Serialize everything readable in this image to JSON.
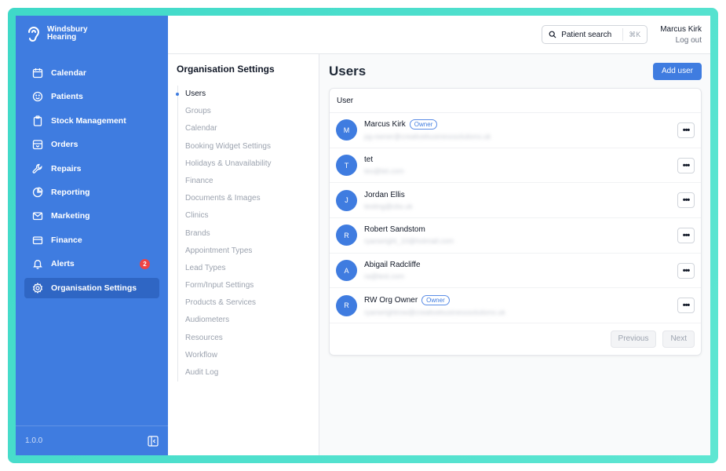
{
  "brand": {
    "name_line1": "Windsbury",
    "name_line2": "Hearing"
  },
  "sidebar": {
    "items": [
      {
        "label": "Calendar",
        "icon": "calendar-icon"
      },
      {
        "label": "Patients",
        "icon": "smile-icon"
      },
      {
        "label": "Stock Management",
        "icon": "clipboard-icon"
      },
      {
        "label": "Orders",
        "icon": "archive-icon"
      },
      {
        "label": "Repairs",
        "icon": "wrench-icon"
      },
      {
        "label": "Reporting",
        "icon": "pie-chart-icon"
      },
      {
        "label": "Marketing",
        "icon": "mail-icon"
      },
      {
        "label": "Finance",
        "icon": "credit-card-icon"
      },
      {
        "label": "Alerts",
        "icon": "bell-icon",
        "badge": "2"
      },
      {
        "label": "Organisation Settings",
        "icon": "settings-icon",
        "active": true
      }
    ],
    "version": "1.0.0"
  },
  "topbar": {
    "search_label": "Patient search",
    "search_shortcut": "⌘K",
    "user_name": "Marcus Kirk",
    "logout_label": "Log out"
  },
  "settings": {
    "title": "Organisation Settings",
    "items": [
      "Users",
      "Groups",
      "Calendar",
      "Booking Widget Settings",
      "Holidays & Unavailability",
      "Finance",
      "Documents & Images",
      "Clinics",
      "Brands",
      "Appointment Types",
      "Lead Types",
      "Form/Input Settings",
      "Products & Services",
      "Audiometers",
      "Resources",
      "Workflow",
      "Audit Log"
    ]
  },
  "users": {
    "title": "Users",
    "add_label": "Add user",
    "column_header": "User",
    "owner_label": "Owner",
    "rows": [
      {
        "initial": "M",
        "name": "Marcus Kirk",
        "owner": true,
        "email": "pg-owner@creativebusinesssolutions.uk"
      },
      {
        "initial": "T",
        "name": "tet",
        "owner": false,
        "email": "tes@tet.com"
      },
      {
        "initial": "J",
        "name": "Jordan Ellis",
        "owner": false,
        "email": "testing@cbs.uk"
      },
      {
        "initial": "R",
        "name": "Robert Sandstom",
        "owner": false,
        "email": "ryanwright_10@hotmail.com"
      },
      {
        "initial": "A",
        "name": "Abigail Radcliffe",
        "owner": false,
        "email": "ra@test.com"
      },
      {
        "initial": "R",
        "name": "RW Org Owner",
        "owner": true,
        "email": "ryanwrightrow@creativebusinesssolutions.uk"
      }
    ],
    "prev_label": "Previous",
    "next_label": "Next"
  },
  "colors": {
    "sidebar": "#3f7ce0",
    "accent": "#3f7ce0",
    "badge": "#ef4444",
    "frame": "#3fd9c8"
  }
}
